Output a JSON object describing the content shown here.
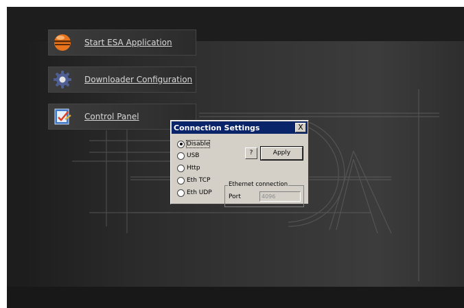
{
  "launcher": {
    "items": [
      {
        "label": "Start ESA Application",
        "icon": "esa-app-icon"
      },
      {
        "label": "Downloader Configuration",
        "icon": "gear-icon"
      },
      {
        "label": "Control Panel",
        "icon": "control-panel-icon"
      }
    ]
  },
  "dialog": {
    "title": "Connection Settings",
    "close_label": "X",
    "help_label": "?",
    "apply_label": "Apply",
    "options": [
      "Disable",
      "USB",
      "Http",
      "Eth TCP",
      "Eth UDP"
    ],
    "selected_option": "Disable",
    "ethernet": {
      "group_label": "Ethernet connection",
      "port_label": "Port",
      "port_value": "4096"
    }
  },
  "colors": {
    "titlebar": "#0a246a",
    "dialog_face": "#d4d0c8",
    "desktop": "#1d1d1d",
    "link_text": "#d8d8d8"
  }
}
